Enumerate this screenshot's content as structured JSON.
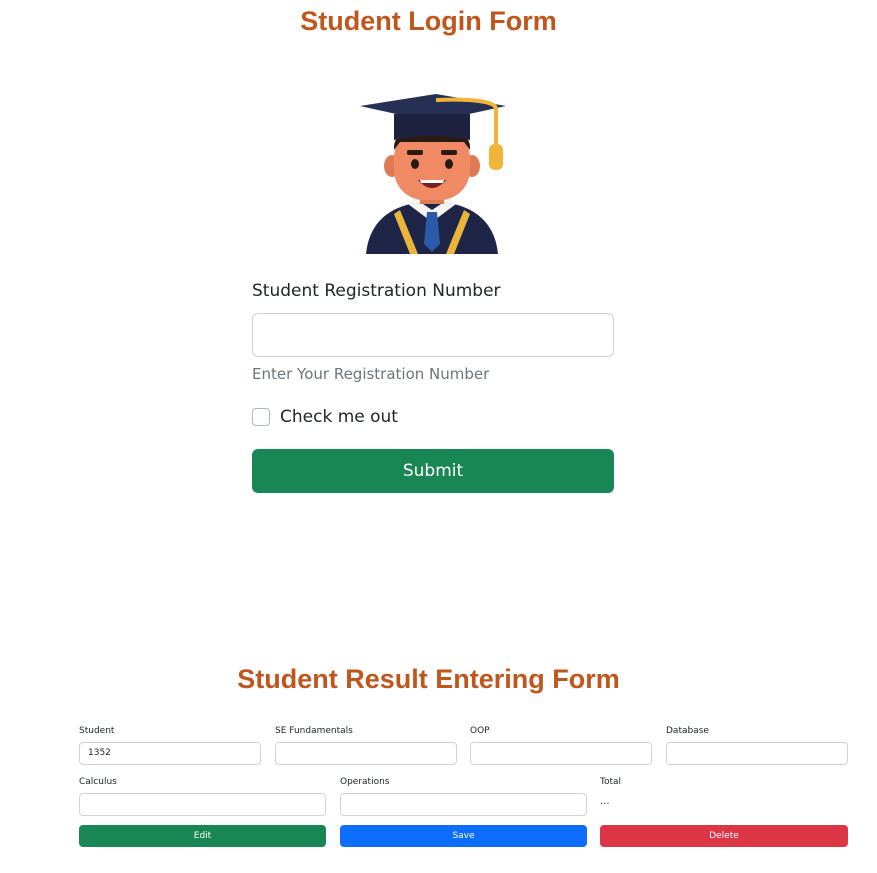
{
  "login": {
    "title": "Student Login Form",
    "avatar_icon": "graduate-avatar-icon",
    "reg_label": "Student Registration Number",
    "reg_value": "",
    "reg_help": "Enter Your Registration Number",
    "check_label": "Check me out",
    "check_checked": false,
    "submit_label": "Submit"
  },
  "result": {
    "title": "Student Result Entering Form",
    "fields": {
      "student": {
        "label": "Student",
        "value": "1352"
      },
      "se": {
        "label": "SE Fundamentals",
        "value": ""
      },
      "oop": {
        "label": "OOP",
        "value": ""
      },
      "database": {
        "label": "Database",
        "value": ""
      },
      "calculus": {
        "label": "Calculus",
        "value": ""
      },
      "operations": {
        "label": "Operations",
        "value": ""
      }
    },
    "total": {
      "label": "Total",
      "value": "..."
    },
    "buttons": {
      "edit": "Edit",
      "save": "Save",
      "delete": "Delete"
    }
  },
  "colors": {
    "title": "#c0561b",
    "submit": "#198754",
    "edit": "#198754",
    "save": "#0d6efd",
    "delete": "#dc3545"
  }
}
